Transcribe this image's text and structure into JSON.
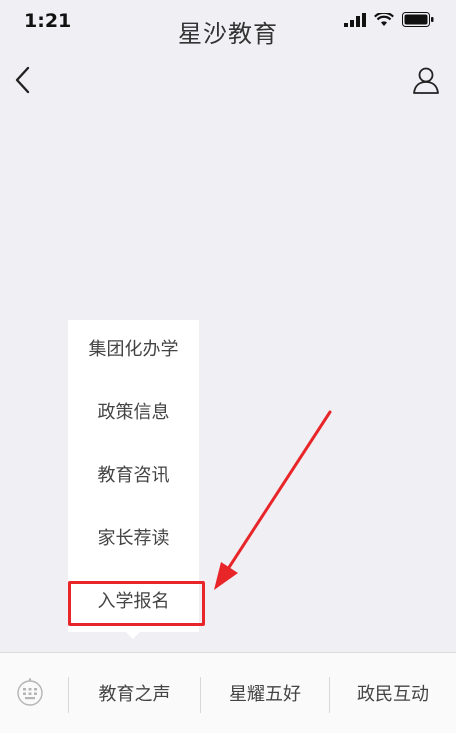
{
  "status_bar": {
    "time": "1:21"
  },
  "nav": {
    "title": "星沙教育"
  },
  "submenu": {
    "items": [
      "集团化办学",
      "政策信息",
      "教育咨讯",
      "家长荐读",
      "入学报名"
    ]
  },
  "bottom_menu": {
    "items": [
      "教育之声",
      "星耀五好",
      "政民互动"
    ]
  },
  "colors": {
    "highlight": "#e8262a",
    "background": "#efeff4"
  }
}
